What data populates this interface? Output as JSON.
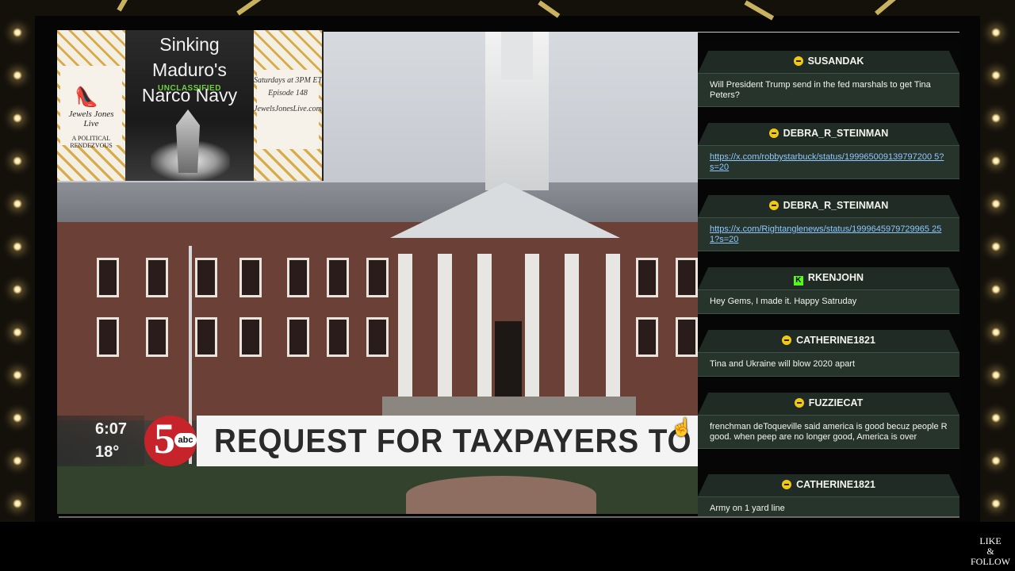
{
  "promo": {
    "title_line1": "Sinking Maduro's",
    "title_line2": "Narco Navy",
    "badge": "UNCLASSIFIED",
    "brand_name_line1": "Jewels Jones",
    "brand_name_line2": "Live",
    "brand_sub": "A POLITICAL RENDEZVOUS",
    "schedule": "Saturdays at 3PM ET",
    "episode": "Episode 148",
    "site": "JewelsJonesLive.com"
  },
  "news": {
    "time": "6:07",
    "temp": "18°",
    "channel_number": "5",
    "network": "abc",
    "headline": "REQUEST FOR TAXPAYERS TO COVE"
  },
  "chat": {
    "messages": [
      {
        "user": "SUSANDAK",
        "text": "Will President Trump send in the fed marshals to get Tina Peters?"
      },
      {
        "user": "DEBRA_R_STEINMAN",
        "text": "https://x.com/robbystarbuck/status/199965009139797200 5?s=20"
      },
      {
        "user": "DEBRA_R_STEINMAN",
        "text": "https://x.com/Rightanglenews/status/1999645979729965 251?s=20"
      },
      {
        "user": "RKENJOHN",
        "text": "Hey Gems, I made it. Happy Satruday"
      },
      {
        "user": "CATHERINE1821",
        "text": "Tina and Ukraine will blow 2020 apart"
      },
      {
        "user": "FUZZIECAT",
        "text": "frenchman deToqueville said america is good becuz people R good. when peep are no longer good, America is over"
      },
      {
        "user": "CATHERINE1821",
        "text": "Army on 1 yard line"
      }
    ]
  },
  "overlay": {
    "like_line1": "LIKE",
    "like_line2": "&",
    "like_line3": "FOLLOW"
  },
  "icons": {
    "chat_badge": "verified-badge-icon",
    "kick_badge": "kick-icon",
    "cursor": "hand-cursor-icon"
  },
  "colors": {
    "chat_header": "#1f2b24",
    "chat_body": "#26342b",
    "link": "#8ec9ff",
    "abc_red": "#c6232b",
    "frame_gold": "#e7cf6e"
  }
}
